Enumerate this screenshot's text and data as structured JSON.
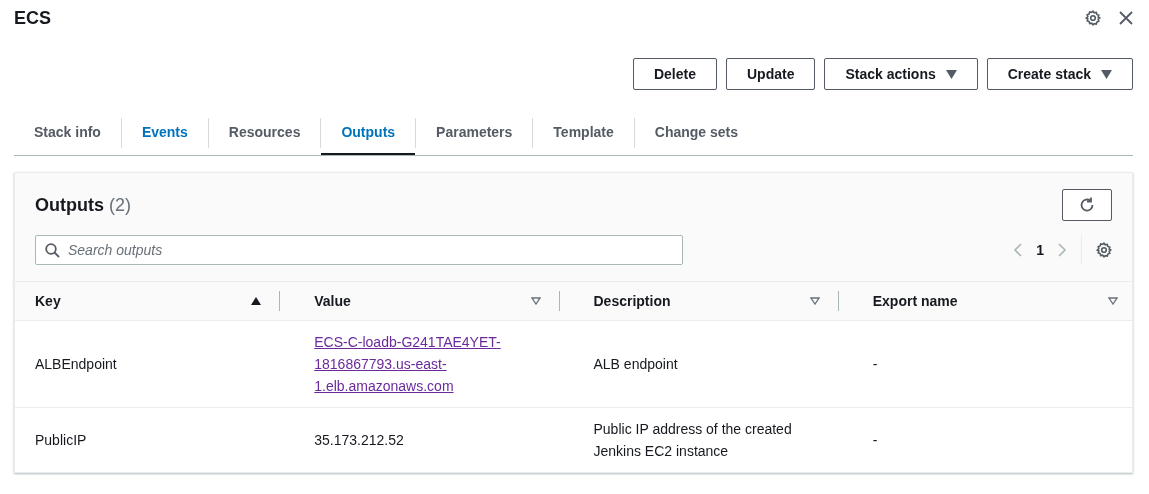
{
  "header": {
    "title": "ECS"
  },
  "actions": [
    {
      "label": "Delete",
      "dropdown": false
    },
    {
      "label": "Update",
      "dropdown": false
    },
    {
      "label": "Stack actions",
      "dropdown": true
    },
    {
      "label": "Create stack",
      "dropdown": true
    }
  ],
  "tabs": [
    {
      "label": "Stack info",
      "selected": false,
      "hovered": false
    },
    {
      "label": "Events",
      "selected": false,
      "hovered": true
    },
    {
      "label": "Resources",
      "selected": false,
      "hovered": false
    },
    {
      "label": "Outputs",
      "selected": true,
      "hovered": false
    },
    {
      "label": "Parameters",
      "selected": false,
      "hovered": false
    },
    {
      "label": "Template",
      "selected": false,
      "hovered": false
    },
    {
      "label": "Change sets",
      "selected": false,
      "hovered": false
    }
  ],
  "panel": {
    "title": "Outputs",
    "count": "(2)",
    "search": {
      "placeholder": "Search outputs"
    },
    "pagination": {
      "page": "1"
    }
  },
  "table": {
    "columns": [
      {
        "label": "Key",
        "sorted": true
      },
      {
        "label": "Value",
        "sorted": false
      },
      {
        "label": "Description",
        "sorted": false
      },
      {
        "label": "Export name",
        "sorted": false
      }
    ],
    "rows": [
      {
        "cells": [
          {
            "kind": "text",
            "text": "ALBEndpoint"
          },
          {
            "kind": "link",
            "text": "ECS-C-loadb-G241TAE4YET-1816867793.us-east-1.elb.amazonaws.com"
          },
          {
            "kind": "text",
            "text": "ALB endpoint"
          },
          {
            "kind": "text",
            "text": "-"
          }
        ]
      },
      {
        "cells": [
          {
            "kind": "text",
            "text": "PublicIP"
          },
          {
            "kind": "text",
            "text": "35.173.212.52"
          },
          {
            "kind": "text",
            "text": "Public IP address of the created Jenkins EC2 instance"
          },
          {
            "kind": "text",
            "text": "-"
          }
        ]
      }
    ]
  }
}
